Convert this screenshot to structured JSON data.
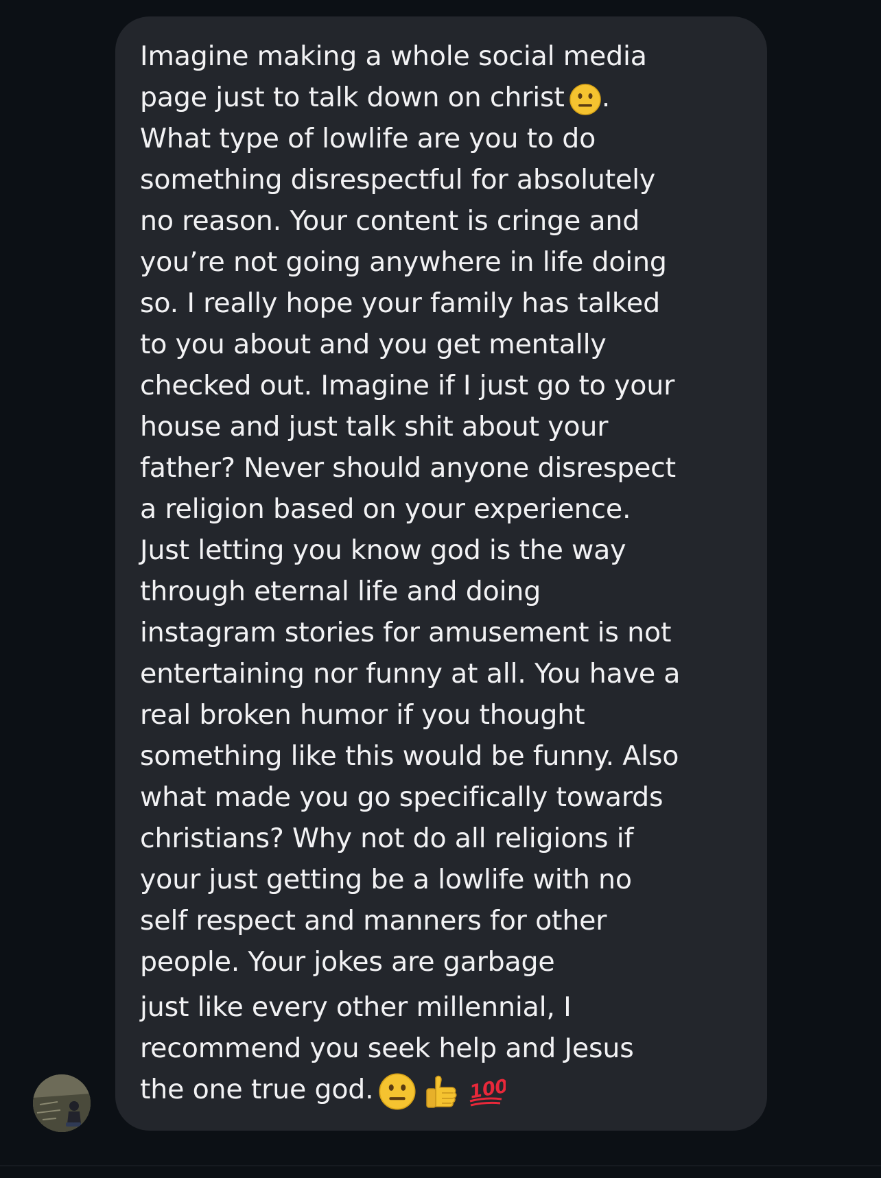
{
  "message": {
    "lines": [
      "Imagine making a whole social media",
      "page just to talk down on christ",
      "What type of lowlife are you to do",
      "something disrespectful for absolutely",
      "no reason. Your content is cringe and",
      "you’re not going anywhere in life doing",
      "so. I really hope your family has talked",
      "to you about and you get mentally",
      "checked out. Imagine if I just go to your",
      "house and just talk shit about your",
      "father? Never should anyone disrespect",
      "a religion based on your experience.",
      "Just letting you know god is the way",
      "through eternal life and doing",
      "instagram stories for amusement is not",
      "entertaining nor funny at all. You have a",
      "real broken humor if you thought",
      "something like this would be funny. Also",
      "what made you go specifically towards",
      "christians? Why not do all religions if",
      "your just getting be a lowlife with no",
      "self respect and manners for other",
      "people. Your jokes are garbage",
      "just like every other millennial, I",
      "recommend you seek help and Jesus",
      "the one true god."
    ],
    "line_2_suffix": ".",
    "emojis": {
      "line_2": [
        "neutral-face"
      ],
      "last_line": [
        "neutral-face",
        "thumbs-up",
        "hundred-points"
      ]
    },
    "hundred_label": "100"
  },
  "colors": {
    "background": "#0c1015",
    "bubble": "#23262c",
    "text": "#f2f2f4",
    "emoji_yellow": "#f5c330",
    "hundred_red": "#e8283a"
  }
}
